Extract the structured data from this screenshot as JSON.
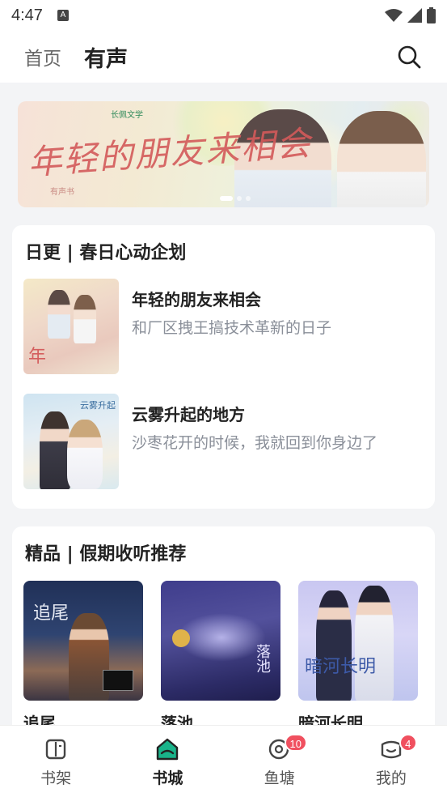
{
  "status_bar": {
    "time": "4:47",
    "app_badge": "A"
  },
  "header": {
    "tabs": [
      {
        "label": "首页",
        "active": false
      },
      {
        "label": "有声",
        "active": true
      }
    ],
    "search_icon": "search-icon"
  },
  "banner": {
    "logo_text": "长佩文学",
    "title": "年轻的朋友来相会",
    "subtitle": "有声书",
    "page_count": 3,
    "active_index": 0
  },
  "daily_section": {
    "title": "日更 | 春日心动企划",
    "books": [
      {
        "title": "年轻的朋友来相会",
        "desc": "和厂区拽王搞技术革新的日子"
      },
      {
        "title": "云雾升起的地方",
        "desc": "沙枣花开的时候，我就回到你身边了"
      }
    ]
  },
  "premium_section": {
    "title": "精品 | 假期收听推荐",
    "books": [
      {
        "title": "追尾",
        "cover_text": "追尾"
      },
      {
        "title": "落池",
        "cover_text": "落池"
      },
      {
        "title": "暗河长明",
        "cover_text": "暗河长明"
      }
    ]
  },
  "bottom_nav": {
    "items": [
      {
        "label": "书架",
        "icon": "bookshelf-icon",
        "active": false,
        "badge": ""
      },
      {
        "label": "书城",
        "icon": "bookstore-icon",
        "active": true,
        "badge": ""
      },
      {
        "label": "鱼塘",
        "icon": "fishpond-icon",
        "active": false,
        "badge": "10"
      },
      {
        "label": "我的",
        "icon": "profile-icon",
        "active": false,
        "badge": "4"
      }
    ]
  },
  "colors": {
    "accent": "#19b38a",
    "badge": "#f0505f",
    "muted_text": "#8a8f99"
  }
}
